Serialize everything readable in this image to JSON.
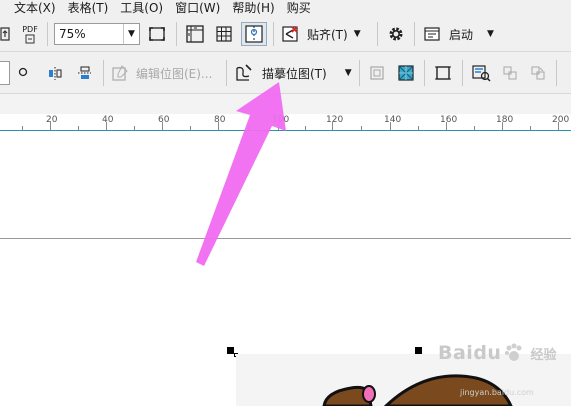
{
  "menu": {
    "items": [
      {
        "label": "文本(X)"
      },
      {
        "label": "表格(T)"
      },
      {
        "label": "工具(O)"
      },
      {
        "label": "窗口(W)"
      },
      {
        "label": "帮助(H)"
      },
      {
        "label": "购买"
      }
    ]
  },
  "toolbar1": {
    "pdf_label": "PDF",
    "zoom_value": "75%",
    "snap_label": "贴齐(T)",
    "launch_label": "启动"
  },
  "toolbar2": {
    "edit_bitmap_label": "编辑位图(E)...",
    "trace_bitmap_label": "描摹位图(T)"
  },
  "ruler": {
    "labels": [
      "20",
      "40",
      "60",
      "80",
      "100",
      "120",
      "140",
      "160",
      "180",
      "200"
    ]
  },
  "watermark": {
    "main": "Baidu",
    "sub": "经验",
    "url": "jingyan.baidu.com"
  },
  "colors": {
    "annotation_arrow": "#f06cf0",
    "ruler_border": "#2d8fb8",
    "cartoon_hair": "#7a4a1e",
    "cartoon_bow": "#f070b8"
  }
}
